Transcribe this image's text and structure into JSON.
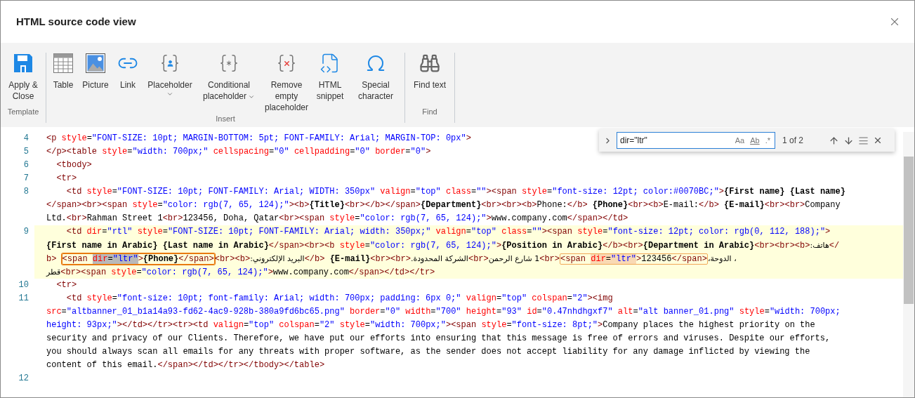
{
  "dialog": {
    "title": "HTML source code view"
  },
  "toolbar": {
    "groups": [
      {
        "label": "Template",
        "buttons": [
          {
            "label": "Apply & Close",
            "dropdown": false
          }
        ]
      },
      {
        "label": "Insert",
        "buttons": [
          {
            "label": "Table",
            "dropdown": false
          },
          {
            "label": "Picture",
            "dropdown": false
          },
          {
            "label": "Link",
            "dropdown": false
          },
          {
            "label": "Placeholder",
            "dropdown": true
          },
          {
            "label": "Conditional placeholder",
            "dropdown": true
          },
          {
            "label": "Remove empty placeholder",
            "dropdown": false
          },
          {
            "label": "HTML snippet",
            "dropdown": false
          },
          {
            "label": "Special character",
            "dropdown": false
          }
        ]
      },
      {
        "label": "Find",
        "buttons": [
          {
            "label": "Find text",
            "dropdown": false
          }
        ]
      }
    ]
  },
  "find_widget": {
    "query": "dir=\"ltr\"",
    "options": [
      "Aa",
      "Ab",
      ".*"
    ],
    "count": "1 of 2"
  },
  "editor": {
    "lines": [
      {
        "number": "4",
        "highlighted": false,
        "rows": [
          {
            "segments": [
              {
                "kind": "tag",
                "text": "<p"
              },
              {
                "kind": "attr",
                "text": " style"
              },
              {
                "kind": "eq",
                "text": "="
              },
              {
                "kind": "value",
                "text": "\"FONT-SIZE: 10pt; MARGIN-BOTTOM: 5pt; FONT-FAMILY: Arial; MARGIN-TOP: 0px\""
              },
              {
                "kind": "tag",
                "text": ">"
              }
            ]
          }
        ]
      },
      {
        "number": "5",
        "highlighted": false,
        "rows": [
          {
            "segments": [
              {
                "kind": "tag",
                "text": "</p><table"
              },
              {
                "kind": "attr",
                "text": " style"
              },
              {
                "kind": "eq",
                "text": "="
              },
              {
                "kind": "value",
                "text": "\"width: 700px;\""
              },
              {
                "kind": "attr",
                "text": " cellspacing"
              },
              {
                "kind": "eq",
                "text": "="
              },
              {
                "kind": "value",
                "text": "\"0\""
              },
              {
                "kind": "attr",
                "text": " cellpadding"
              },
              {
                "kind": "eq",
                "text": "="
              },
              {
                "kind": "value",
                "text": "\"0\""
              },
              {
                "kind": "attr",
                "text": " border"
              },
              {
                "kind": "eq",
                "text": "="
              },
              {
                "kind": "value",
                "text": "\"0\""
              },
              {
                "kind": "tag",
                "text": ">"
              }
            ]
          }
        ]
      },
      {
        "number": "6",
        "highlighted": false,
        "rows": [
          {
            "segments": [
              {
                "kind": "tag",
                "text": "  <tbody>"
              }
            ]
          }
        ]
      },
      {
        "number": "7",
        "highlighted": false,
        "rows": [
          {
            "segments": [
              {
                "kind": "tag",
                "text": "  <tr>"
              }
            ]
          }
        ]
      },
      {
        "number": "8",
        "highlighted": false,
        "rows": [
          {
            "segments": [
              {
                "kind": "tag",
                "text": "    <td"
              },
              {
                "kind": "attr",
                "text": " style"
              },
              {
                "kind": "eq",
                "text": "="
              },
              {
                "kind": "value",
                "text": "\"FONT-SIZE: 10pt; FONT-FAMILY: Arial; WIDTH: 350px\""
              },
              {
                "kind": "attr",
                "text": " valign"
              },
              {
                "kind": "eq",
                "text": "="
              },
              {
                "kind": "value",
                "text": "\"top\""
              },
              {
                "kind": "attr",
                "text": " class"
              },
              {
                "kind": "eq",
                "text": "="
              },
              {
                "kind": "value",
                "text": "\"\""
              },
              {
                "kind": "tag",
                "text": "><span"
              },
              {
                "kind": "attr",
                "text": " style"
              },
              {
                "kind": "eq",
                "text": "="
              },
              {
                "kind": "value",
                "text": "\"font-size: 12pt; color:#0070BC;\""
              },
              {
                "kind": "tag",
                "text": ">"
              },
              {
                "kind": "bold",
                "text": "{First name} {Last name}"
              }
            ]
          },
          {
            "segments": [
              {
                "kind": "tag",
                "text": "</span><br><span"
              },
              {
                "kind": "attr",
                "text": " style"
              },
              {
                "kind": "eq",
                "text": "="
              },
              {
                "kind": "value",
                "text": "\"color: rgb(7, 65, 124);\""
              },
              {
                "kind": "tag",
                "text": "><b>"
              },
              {
                "kind": "bold",
                "text": "{Title}"
              },
              {
                "kind": "tag",
                "text": "<br></b></span>"
              },
              {
                "kind": "bold",
                "text": "{Department}"
              },
              {
                "kind": "tag",
                "text": "<br><br><b>"
              },
              {
                "kind": "text",
                "text": "Phone:"
              },
              {
                "kind": "tag",
                "text": "</b>"
              },
              {
                "kind": "bold",
                "text": " {Phone}"
              },
              {
                "kind": "tag",
                "text": "<br><b>"
              },
              {
                "kind": "text",
                "text": "E-mail:"
              },
              {
                "kind": "tag",
                "text": "</b>"
              },
              {
                "kind": "bold",
                "text": " {E-mail}"
              },
              {
                "kind": "tag",
                "text": "<br><br>"
              },
              {
                "kind": "text",
                "text": "Company"
              }
            ]
          },
          {
            "segments": [
              {
                "kind": "text",
                "text": "Ltd."
              },
              {
                "kind": "tag",
                "text": "<br>"
              },
              {
                "kind": "text",
                "text": "Rahman Street 1"
              },
              {
                "kind": "tag",
                "text": "<br>"
              },
              {
                "kind": "text",
                "text": "123456, Doha, Qatar"
              },
              {
                "kind": "tag",
                "text": "<br><span"
              },
              {
                "kind": "attr",
                "text": " style"
              },
              {
                "kind": "eq",
                "text": "="
              },
              {
                "kind": "value",
                "text": "\"color: rgb(7, 65, 124);\""
              },
              {
                "kind": "tag",
                "text": ">"
              },
              {
                "kind": "text",
                "text": "www.company.com"
              },
              {
                "kind": "tag",
                "text": "</span></td>"
              }
            ]
          }
        ]
      },
      {
        "number": "9",
        "highlighted": true,
        "rows": [
          {
            "segments": [
              {
                "kind": "tag",
                "text": "    <td"
              },
              {
                "kind": "attr",
                "text": " dir"
              },
              {
                "kind": "eq",
                "text": "="
              },
              {
                "kind": "value",
                "text": "\"rtl\""
              },
              {
                "kind": "attr",
                "text": " style"
              },
              {
                "kind": "eq",
                "text": "="
              },
              {
                "kind": "value",
                "text": "\"FONT-SIZE: 10pt; FONT-FAMILY: Arial; width: 350px;\""
              },
              {
                "kind": "attr",
                "text": " valign"
              },
              {
                "kind": "eq",
                "text": "="
              },
              {
                "kind": "value",
                "text": "\"top\""
              },
              {
                "kind": "attr",
                "text": " class"
              },
              {
                "kind": "eq",
                "text": "="
              },
              {
                "kind": "value",
                "text": "\"\""
              },
              {
                "kind": "tag",
                "text": "><span"
              },
              {
                "kind": "attr",
                "text": " style"
              },
              {
                "kind": "eq",
                "text": "="
              },
              {
                "kind": "value",
                "text": "\"font-size: 12pt; color: rgb(0, 112, 188);\""
              },
              {
                "kind": "tag",
                "text": ">"
              }
            ]
          },
          {
            "segments": [
              {
                "kind": "bold",
                "text": "{First name in Arabic} {Last name in Arabic}"
              },
              {
                "kind": "tag",
                "text": "</span><br><b"
              },
              {
                "kind": "attr",
                "text": " style"
              },
              {
                "kind": "eq",
                "text": "="
              },
              {
                "kind": "value",
                "text": "\"color: rgb(7, 65, 124);\""
              },
              {
                "kind": "tag",
                "text": ">"
              },
              {
                "kind": "bold",
                "text": "{Position in Arabic}"
              },
              {
                "kind": "tag",
                "text": "</b><br>"
              },
              {
                "kind": "bold",
                "text": "{Department in Arabic}"
              },
              {
                "kind": "tag",
                "text": "<br><br><b>"
              },
              {
                "kind": "rtl_text",
                "text": "هاتف:"
              },
              {
                "kind": "tag",
                "text": "</"
              }
            ]
          },
          {
            "segments": [
              {
                "kind": "tag",
                "text": "b> "
              },
              {
                "kind": "match",
                "current": true,
                "parts": [
                  {
                    "kind": "tag",
                    "text": "<span ",
                    "found": false
                  },
                  {
                    "kind": "attr",
                    "text": "dir",
                    "found": true
                  },
                  {
                    "kind": "eq",
                    "text": "=",
                    "found": true
                  },
                  {
                    "kind": "value",
                    "text": "\"ltr\"",
                    "found": true
                  },
                  {
                    "kind": "tag",
                    "text": ">",
                    "found": false
                  },
                  {
                    "kind": "bold",
                    "text": "{Phone}",
                    "found": false
                  },
                  {
                    "kind": "tag",
                    "text": "</span>",
                    "found": false
                  }
                ]
              },
              {
                "kind": "tag",
                "text": "<br><b>"
              },
              {
                "kind": "rtl_text",
                "text": "البريد الإلكتروني:"
              },
              {
                "kind": "tag",
                "text": "</b>"
              },
              {
                "kind": "bold",
                "text": " {E-mail}"
              },
              {
                "kind": "tag",
                "text": "<br><br>"
              },
              {
                "kind": "rtl_text",
                "text": "الشركة المحدودة."
              },
              {
                "kind": "tag",
                "text": "<br>"
              },
              {
                "kind": "rtl_text",
                "text": "1 شارع الرحمن"
              },
              {
                "kind": "tag",
                "text": "<br>"
              },
              {
                "kind": "match",
                "current": false,
                "parts": [
                  {
                    "kind": "tag",
                    "text": "<span ",
                    "found": false
                  },
                  {
                    "kind": "attr",
                    "text": "dir",
                    "found": true
                  },
                  {
                    "kind": "eq",
                    "text": "=",
                    "found": true
                  },
                  {
                    "kind": "value",
                    "text": "\"ltr\"",
                    "found": true
                  },
                  {
                    "kind": "tag",
                    "text": ">",
                    "found": false
                  },
                  {
                    "kind": "text",
                    "text": "123456",
                    "found": false
                  },
                  {
                    "kind": "tag",
                    "text": "</span>",
                    "found": false
                  }
                ]
              },
              {
                "kind": "rtl_text",
                "text": "، الدوحة،"
              }
            ]
          },
          {
            "segments": [
              {
                "kind": "rtl_text",
                "text": "قطر"
              },
              {
                "kind": "tag",
                "text": "<br><span"
              },
              {
                "kind": "attr",
                "text": " style"
              },
              {
                "kind": "eq",
                "text": "="
              },
              {
                "kind": "value",
                "text": "\"color: rgb(7, 65, 124);\""
              },
              {
                "kind": "tag",
                "text": ">"
              },
              {
                "kind": "text",
                "text": "www.company.com"
              },
              {
                "kind": "tag",
                "text": "</span></td></tr>"
              }
            ]
          }
        ]
      },
      {
        "number": "10",
        "highlighted": false,
        "rows": [
          {
            "segments": [
              {
                "kind": "tag",
                "text": "  <tr>"
              }
            ]
          }
        ]
      },
      {
        "number": "11",
        "highlighted": false,
        "rows": [
          {
            "segments": [
              {
                "kind": "tag",
                "text": "    <td"
              },
              {
                "kind": "attr",
                "text": " style"
              },
              {
                "kind": "eq",
                "text": "="
              },
              {
                "kind": "value",
                "text": "\"font-size: 10pt; font-family: Arial; width: 700px; padding: 6px 0;\""
              },
              {
                "kind": "attr",
                "text": " valign"
              },
              {
                "kind": "eq",
                "text": "="
              },
              {
                "kind": "value",
                "text": "\"top\""
              },
              {
                "kind": "attr",
                "text": " colspan"
              },
              {
                "kind": "eq",
                "text": "="
              },
              {
                "kind": "value",
                "text": "\"2\""
              },
              {
                "kind": "tag",
                "text": "><img"
              }
            ]
          },
          {
            "segments": [
              {
                "kind": "attr",
                "text": "src"
              },
              {
                "kind": "eq",
                "text": "="
              },
              {
                "kind": "value",
                "text": "\"altbanner_01_b1a14a93-fd62-4ac9-928b-380a9fd6bc65.png\""
              },
              {
                "kind": "attr",
                "text": " border"
              },
              {
                "kind": "eq",
                "text": "="
              },
              {
                "kind": "value",
                "text": "\"0\""
              },
              {
                "kind": "attr",
                "text": " width"
              },
              {
                "kind": "eq",
                "text": "="
              },
              {
                "kind": "value",
                "text": "\"700\""
              },
              {
                "kind": "attr",
                "text": " height"
              },
              {
                "kind": "eq",
                "text": "="
              },
              {
                "kind": "value",
                "text": "\"93\""
              },
              {
                "kind": "attr",
                "text": " id"
              },
              {
                "kind": "eq",
                "text": "="
              },
              {
                "kind": "value",
                "text": "\"0.47nhdhgxf7\""
              },
              {
                "kind": "attr",
                "text": " alt"
              },
              {
                "kind": "eq",
                "text": "="
              },
              {
                "kind": "value",
                "text": "\"alt banner_01.png\""
              },
              {
                "kind": "attr",
                "text": " style"
              },
              {
                "kind": "eq",
                "text": "="
              },
              {
                "kind": "value",
                "text": "\"width: 700px;"
              }
            ]
          },
          {
            "segments": [
              {
                "kind": "value",
                "text": "height: 93px;\""
              },
              {
                "kind": "tag",
                "text": "></td></tr><tr><td"
              },
              {
                "kind": "attr",
                "text": " valign"
              },
              {
                "kind": "eq",
                "text": "="
              },
              {
                "kind": "value",
                "text": "\"top\""
              },
              {
                "kind": "attr",
                "text": " colspan"
              },
              {
                "kind": "eq",
                "text": "="
              },
              {
                "kind": "value",
                "text": "\"2\""
              },
              {
                "kind": "attr",
                "text": " style"
              },
              {
                "kind": "eq",
                "text": "="
              },
              {
                "kind": "value",
                "text": "\"width: 700px;\""
              },
              {
                "kind": "tag",
                "text": "><span"
              },
              {
                "kind": "attr",
                "text": " style"
              },
              {
                "kind": "eq",
                "text": "="
              },
              {
                "kind": "value",
                "text": "\"font-size: 8pt;\""
              },
              {
                "kind": "tag",
                "text": ">"
              },
              {
                "kind": "text",
                "text": "Company places the highest priority on the"
              }
            ]
          },
          {
            "segments": [
              {
                "kind": "text",
                "text": "security and privacy of our Clients. Therefore, we have put our efforts into ensuring that this message is free of errors and viruses. Despite our efforts,"
              }
            ]
          },
          {
            "segments": [
              {
                "kind": "text",
                "text": "you should always scan all emails for any threats with proper software, as the sender does not accept liability for any damage inflicted by viewing the"
              }
            ]
          },
          {
            "segments": [
              {
                "kind": "text",
                "text": "content of this email."
              },
              {
                "kind": "tag",
                "text": "</span></td></tr></tbody></table>"
              }
            ]
          }
        ]
      },
      {
        "number": "12",
        "highlighted": false
      }
    ]
  }
}
